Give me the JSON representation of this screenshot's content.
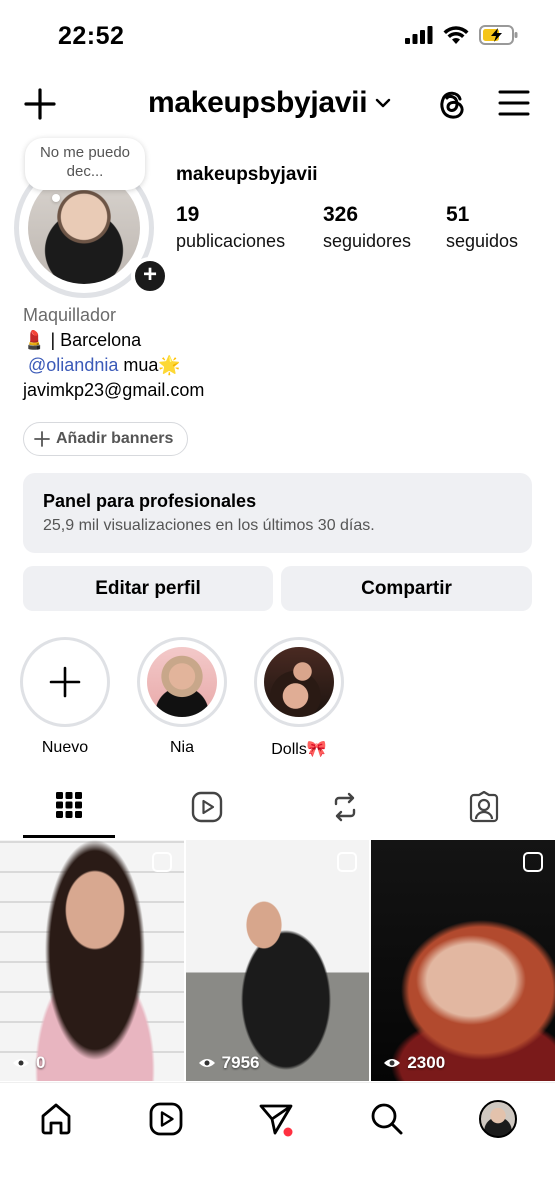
{
  "status_bar": {
    "time": "22:52"
  },
  "header": {
    "username": "makeupsbyjavii"
  },
  "note": {
    "text": "No me puedo dec..."
  },
  "profile": {
    "name": "makeupsbyjavii",
    "stats": [
      {
        "value": "19",
        "label": "publicaciones"
      },
      {
        "value": "326",
        "label": "seguidores"
      },
      {
        "value": "51",
        "label": "seguidos"
      }
    ],
    "bio": {
      "category": "Maquillador",
      "line1_emoji": "💄",
      "line1_text": "| Barcelona",
      "mention": "@oliandnia",
      "line2_text": "mua",
      "line2_emoji": "🌟",
      "email": "javimkp23@gmail.com"
    }
  },
  "banners": {
    "label": "Añadir banners"
  },
  "pro_panel": {
    "title": "Panel para profesionales",
    "subtitle": "25,9 mil visualizaciones en los últimos 30 días."
  },
  "actions": {
    "edit": "Editar perfil",
    "share": "Compartir"
  },
  "highlights": [
    {
      "label": "Nuevo"
    },
    {
      "label": "Nia"
    },
    {
      "label": "Dolls🎀"
    }
  ],
  "tabs": [
    "grid-icon",
    "reels-icon",
    "reposts-icon",
    "tagged-icon"
  ],
  "posts": [
    {
      "views": "0"
    },
    {
      "views": "7956"
    },
    {
      "views": "2300"
    }
  ],
  "bottom_nav": [
    "home-icon",
    "reels-icon",
    "messages-icon",
    "search-icon",
    "profile-avatar"
  ],
  "colors": {
    "accent_link": "#3b5ab8",
    "notification_dot": "#ff3040",
    "panel_bg": "#eff0f3"
  }
}
